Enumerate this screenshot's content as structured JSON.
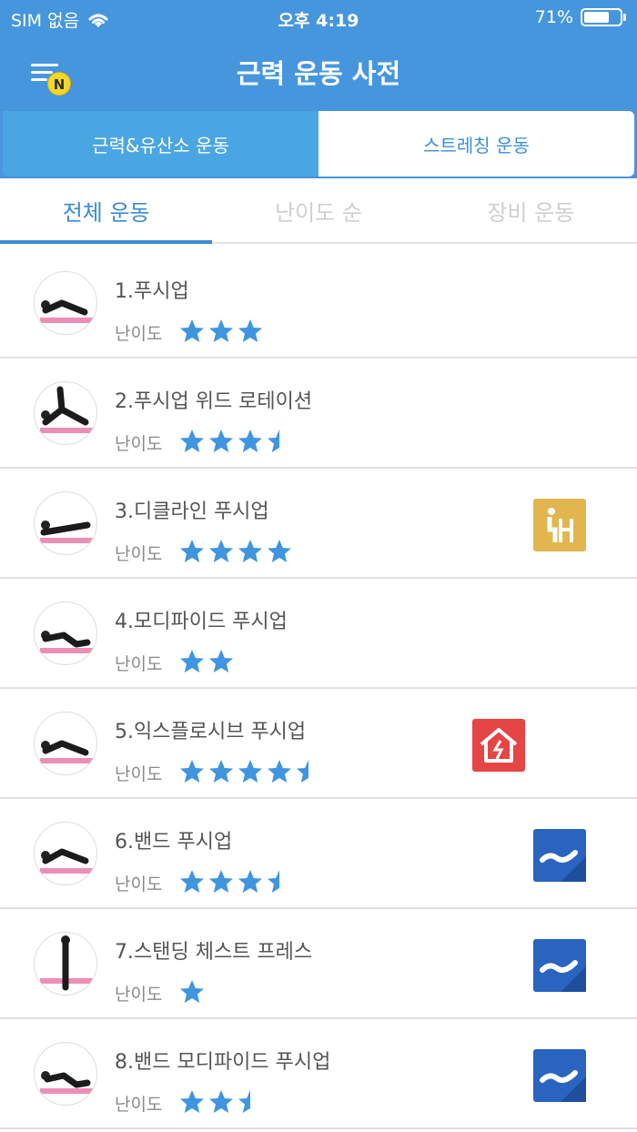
{
  "status": {
    "carrier": "SIM 없음",
    "time": "오후 4:19",
    "battery": "71%",
    "battery_level": 0.71
  },
  "header": {
    "title": "근력 운동 사전"
  },
  "segments": [
    "근력&유산소 운동",
    "스트레칭 운동"
  ],
  "tabs": [
    "전체 운동",
    "난이도 순",
    "장비 운동"
  ],
  "difficulty_label": "난이도",
  "colors": {
    "header": "#4696dd",
    "accent": "#3b8bd5",
    "star": "#3f95df",
    "yellow": "#e1b64e",
    "red": "#e54545",
    "blue": "#2a64c0"
  },
  "exercises": [
    {
      "name": "1.푸시업",
      "rating": 3,
      "tag": "none"
    },
    {
      "name": "2.푸시업 위드 로테이션",
      "rating": 3.5,
      "tag": "none"
    },
    {
      "name": "3.디클라인 푸시업",
      "rating": 4,
      "tag": "chair-icon"
    },
    {
      "name": "4.모디파이드 푸시업",
      "rating": 2,
      "tag": "none"
    },
    {
      "name": "5.익스플로시브 푸시업",
      "rating": 4.5,
      "tag": "noise-warning-icon"
    },
    {
      "name": "6.밴드 푸시업",
      "rating": 3.5,
      "tag": "band-icon"
    },
    {
      "name": "7.스탠딩 체스트 프레스",
      "rating": 1,
      "tag": "band-icon"
    },
    {
      "name": "8.밴드 모디파이드 푸시업",
      "rating": 2.5,
      "tag": "band-icon"
    }
  ]
}
